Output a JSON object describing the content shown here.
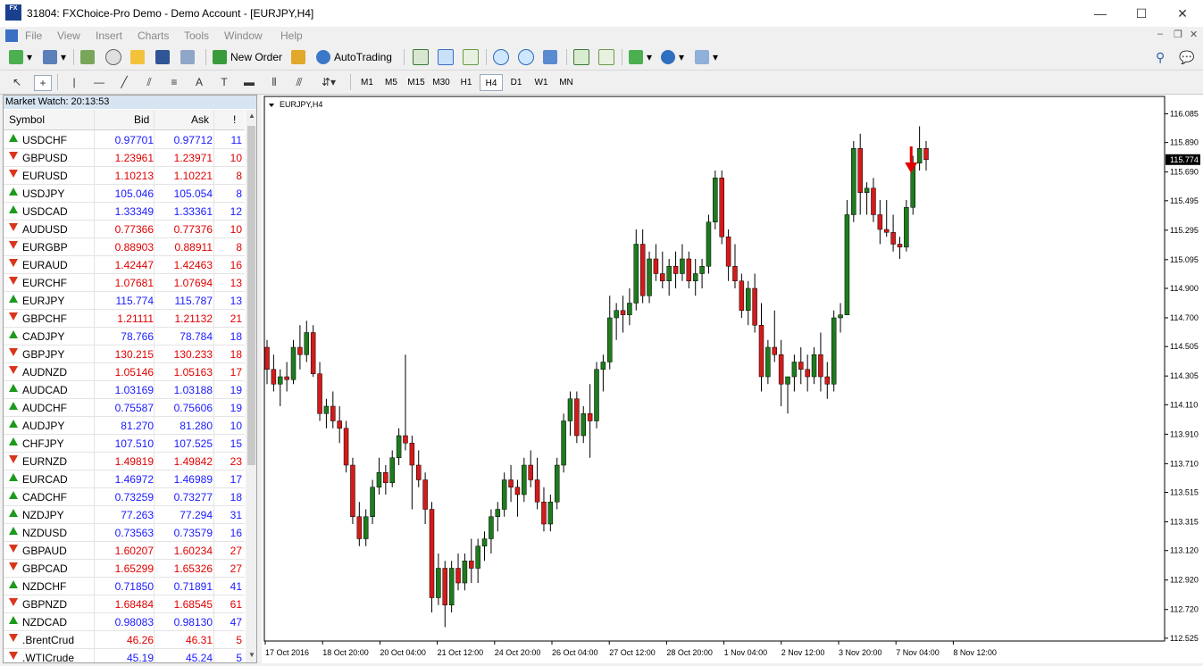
{
  "window": {
    "title": "31804: FXChoice-Pro Demo - Demo Account - [EURJPY,H4]",
    "app_icon_text": "FX",
    "minimize": "—",
    "maximize": "☐",
    "close": "✕"
  },
  "menu": [
    "File",
    "View",
    "Insert",
    "Charts",
    "Tools",
    "Window",
    "Help"
  ],
  "toolbar": {
    "new_order": "New Order",
    "auto_trading": "AutoTrading"
  },
  "timeframes": [
    "M1",
    "M5",
    "M15",
    "M30",
    "H1",
    "H4",
    "D1",
    "W1",
    "MN"
  ],
  "active_timeframe": "H4",
  "market_watch": {
    "title": "Market Watch: 20:13:53",
    "columns": [
      "Symbol",
      "Bid",
      "Ask",
      "!"
    ],
    "rows": [
      {
        "dir": "up",
        "symbol": "USDCHF",
        "bid": "0.97701",
        "ask": "0.97712",
        "spread": "11",
        "color": "#1a1aff"
      },
      {
        "dir": "down",
        "symbol": "GBPUSD",
        "bid": "1.23961",
        "ask": "1.23971",
        "spread": "10",
        "color": "#e00000"
      },
      {
        "dir": "down",
        "symbol": "EURUSD",
        "bid": "1.10213",
        "ask": "1.10221",
        "spread": "8",
        "color": "#e00000"
      },
      {
        "dir": "up",
        "symbol": "USDJPY",
        "bid": "105.046",
        "ask": "105.054",
        "spread": "8",
        "color": "#1a1aff"
      },
      {
        "dir": "up",
        "symbol": "USDCAD",
        "bid": "1.33349",
        "ask": "1.33361",
        "spread": "12",
        "color": "#1a1aff"
      },
      {
        "dir": "down",
        "symbol": "AUDUSD",
        "bid": "0.77366",
        "ask": "0.77376",
        "spread": "10",
        "color": "#e00000"
      },
      {
        "dir": "down",
        "symbol": "EURGBP",
        "bid": "0.88903",
        "ask": "0.88911",
        "spread": "8",
        "color": "#e00000"
      },
      {
        "dir": "down",
        "symbol": "EURAUD",
        "bid": "1.42447",
        "ask": "1.42463",
        "spread": "16",
        "color": "#e00000"
      },
      {
        "dir": "down",
        "symbol": "EURCHF",
        "bid": "1.07681",
        "ask": "1.07694",
        "spread": "13",
        "color": "#e00000"
      },
      {
        "dir": "up",
        "symbol": "EURJPY",
        "bid": "115.774",
        "ask": "115.787",
        "spread": "13",
        "color": "#1a1aff"
      },
      {
        "dir": "down",
        "symbol": "GBPCHF",
        "bid": "1.21111",
        "ask": "1.21132",
        "spread": "21",
        "color": "#e00000"
      },
      {
        "dir": "up",
        "symbol": "CADJPY",
        "bid": "78.766",
        "ask": "78.784",
        "spread": "18",
        "color": "#1a1aff"
      },
      {
        "dir": "down",
        "symbol": "GBPJPY",
        "bid": "130.215",
        "ask": "130.233",
        "spread": "18",
        "color": "#e00000"
      },
      {
        "dir": "down",
        "symbol": "AUDNZD",
        "bid": "1.05146",
        "ask": "1.05163",
        "spread": "17",
        "color": "#e00000"
      },
      {
        "dir": "up",
        "symbol": "AUDCAD",
        "bid": "1.03169",
        "ask": "1.03188",
        "spread": "19",
        "color": "#1a1aff"
      },
      {
        "dir": "up",
        "symbol": "AUDCHF",
        "bid": "0.75587",
        "ask": "0.75606",
        "spread": "19",
        "color": "#1a1aff"
      },
      {
        "dir": "up",
        "symbol": "AUDJPY",
        "bid": "81.270",
        "ask": "81.280",
        "spread": "10",
        "color": "#1a1aff"
      },
      {
        "dir": "up",
        "symbol": "CHFJPY",
        "bid": "107.510",
        "ask": "107.525",
        "spread": "15",
        "color": "#1a1aff"
      },
      {
        "dir": "down",
        "symbol": "EURNZD",
        "bid": "1.49819",
        "ask": "1.49842",
        "spread": "23",
        "color": "#e00000"
      },
      {
        "dir": "up",
        "symbol": "EURCAD",
        "bid": "1.46972",
        "ask": "1.46989",
        "spread": "17",
        "color": "#1a1aff"
      },
      {
        "dir": "up",
        "symbol": "CADCHF",
        "bid": "0.73259",
        "ask": "0.73277",
        "spread": "18",
        "color": "#1a1aff"
      },
      {
        "dir": "up",
        "symbol": "NZDJPY",
        "bid": "77.263",
        "ask": "77.294",
        "spread": "31",
        "color": "#1a1aff"
      },
      {
        "dir": "up",
        "symbol": "NZDUSD",
        "bid": "0.73563",
        "ask": "0.73579",
        "spread": "16",
        "color": "#1a1aff"
      },
      {
        "dir": "down",
        "symbol": "GBPAUD",
        "bid": "1.60207",
        "ask": "1.60234",
        "spread": "27",
        "color": "#e00000"
      },
      {
        "dir": "down",
        "symbol": "GBPCAD",
        "bid": "1.65299",
        "ask": "1.65326",
        "spread": "27",
        "color": "#e00000"
      },
      {
        "dir": "up",
        "symbol": "NZDCHF",
        "bid": "0.71850",
        "ask": "0.71891",
        "spread": "41",
        "color": "#1a1aff"
      },
      {
        "dir": "down",
        "symbol": "GBPNZD",
        "bid": "1.68484",
        "ask": "1.68545",
        "spread": "61",
        "color": "#e00000"
      },
      {
        "dir": "up",
        "symbol": "NZDCAD",
        "bid": "0.98083",
        "ask": "0.98130",
        "spread": "47",
        "color": "#1a1aff"
      },
      {
        "dir": "down",
        "symbol": ".BrentCrud",
        "bid": "46.26",
        "ask": "46.31",
        "spread": "5",
        "color": "#e00000"
      },
      {
        "dir": "down",
        "symbol": ".WTICrude",
        "bid": "45.19",
        "ask": "45.24",
        "spread": "5",
        "color": "#1a1aff"
      }
    ]
  },
  "chart_data": {
    "type": "candlestick",
    "title": "EURJPY,H4",
    "current_price": "115.774",
    "ylim": [
      112.5,
      116.1
    ],
    "y_ticks": [
      "116.085",
      "115.890",
      "115.690",
      "115.495",
      "115.295",
      "115.095",
      "114.900",
      "114.700",
      "114.505",
      "114.305",
      "114.110",
      "113.910",
      "113.710",
      "113.515",
      "113.315",
      "113.120",
      "112.920",
      "112.720",
      "112.525"
    ],
    "x_labels": [
      "17 Oct 2016",
      "18 Oct 20:00",
      "20 Oct 04:00",
      "21 Oct 12:00",
      "24 Oct 20:00",
      "26 Oct 04:00",
      "27 Oct 12:00",
      "28 Oct 20:00",
      "1 Nov 04:00",
      "2 Nov 12:00",
      "3 Nov 20:00",
      "7 Nov 04:00",
      "8 Nov 12:00"
    ],
    "marker": "down-arrow above 7 Nov 04:00 candle",
    "candles": [
      [
        114.5,
        114.55,
        114.25,
        114.35
      ],
      [
        114.35,
        114.45,
        114.2,
        114.25
      ],
      [
        114.25,
        114.35,
        114.1,
        114.3
      ],
      [
        114.3,
        114.4,
        114.2,
        114.28
      ],
      [
        114.28,
        114.55,
        114.25,
        114.5
      ],
      [
        114.5,
        114.65,
        114.35,
        114.45
      ],
      [
        114.45,
        114.68,
        114.4,
        114.6
      ],
      [
        114.6,
        114.65,
        114.3,
        114.32
      ],
      [
        114.32,
        114.4,
        114.0,
        114.05
      ],
      [
        114.05,
        114.15,
        113.95,
        114.1
      ],
      [
        114.1,
        114.2,
        113.95,
        114.0
      ],
      [
        114.0,
        114.1,
        113.85,
        113.95
      ],
      [
        113.95,
        114.0,
        113.65,
        113.7
      ],
      [
        113.7,
        113.75,
        113.3,
        113.35
      ],
      [
        113.35,
        113.45,
        113.15,
        113.2
      ],
      [
        113.2,
        113.4,
        113.15,
        113.35
      ],
      [
        113.35,
        113.6,
        113.3,
        113.55
      ],
      [
        113.55,
        113.75,
        113.5,
        113.65
      ],
      [
        113.65,
        113.7,
        113.5,
        113.58
      ],
      [
        113.58,
        113.8,
        113.55,
        113.75
      ],
      [
        113.75,
        113.95,
        113.7,
        113.9
      ],
      [
        113.9,
        114.45,
        113.8,
        113.85
      ],
      [
        113.85,
        113.9,
        113.4,
        113.7
      ],
      [
        113.7,
        113.8,
        113.55,
        113.6
      ],
      [
        113.6,
        113.65,
        113.3,
        113.4
      ],
      [
        113.4,
        113.45,
        112.7,
        112.8
      ],
      [
        112.8,
        113.1,
        112.75,
        113.0
      ],
      [
        113.0,
        113.05,
        112.6,
        112.75
      ],
      [
        112.75,
        113.05,
        112.7,
        113.0
      ],
      [
        113.0,
        113.1,
        112.85,
        112.9
      ],
      [
        112.9,
        113.1,
        112.85,
        113.05
      ],
      [
        113.05,
        113.2,
        112.9,
        113.0
      ],
      [
        113.0,
        113.2,
        112.9,
        113.15
      ],
      [
        113.15,
        113.25,
        113.05,
        113.2
      ],
      [
        113.2,
        113.4,
        113.1,
        113.35
      ],
      [
        113.35,
        113.45,
        113.25,
        113.4
      ],
      [
        113.4,
        113.65,
        113.35,
        113.6
      ],
      [
        113.6,
        113.7,
        113.45,
        113.55
      ],
      [
        113.55,
        113.6,
        113.35,
        113.5
      ],
      [
        113.5,
        113.75,
        113.45,
        113.7
      ],
      [
        113.7,
        113.8,
        113.55,
        113.6
      ],
      [
        113.6,
        113.75,
        113.4,
        113.45
      ],
      [
        113.45,
        113.55,
        113.25,
        113.3
      ],
      [
        113.3,
        113.5,
        113.25,
        113.45
      ],
      [
        113.45,
        113.75,
        113.4,
        113.7
      ],
      [
        113.7,
        114.05,
        113.65,
        114.0
      ],
      [
        114.0,
        114.2,
        113.9,
        114.15
      ],
      [
        114.15,
        114.2,
        113.85,
        113.9
      ],
      [
        113.9,
        114.1,
        113.85,
        114.05
      ],
      [
        114.05,
        114.25,
        113.75,
        114.0
      ],
      [
        114.0,
        114.4,
        113.95,
        114.35
      ],
      [
        114.35,
        114.45,
        114.2,
        114.4
      ],
      [
        114.4,
        114.85,
        114.35,
        114.7
      ],
      [
        114.7,
        114.8,
        114.55,
        114.75
      ],
      [
        114.75,
        114.85,
        114.6,
        114.72
      ],
      [
        114.72,
        114.9,
        114.65,
        114.8
      ],
      [
        114.8,
        115.3,
        114.75,
        115.2
      ],
      [
        115.2,
        115.3,
        114.8,
        114.85
      ],
      [
        114.85,
        115.15,
        114.8,
        115.1
      ],
      [
        115.1,
        115.2,
        114.95,
        115.0
      ],
      [
        115.0,
        115.15,
        114.9,
        114.95
      ],
      [
        114.95,
        115.1,
        114.85,
        115.05
      ],
      [
        115.05,
        115.15,
        114.9,
        115.0
      ],
      [
        115.0,
        115.2,
        114.95,
        115.1
      ],
      [
        115.1,
        115.15,
        114.9,
        114.95
      ],
      [
        114.95,
        115.1,
        114.85,
        115.0
      ],
      [
        115.0,
        115.1,
        114.9,
        115.05
      ],
      [
        115.05,
        115.4,
        115.0,
        115.35
      ],
      [
        115.35,
        115.7,
        115.3,
        115.65
      ],
      [
        115.65,
        115.7,
        115.2,
        115.25
      ],
      [
        115.25,
        115.3,
        114.95,
        115.05
      ],
      [
        115.05,
        115.2,
        114.9,
        114.95
      ],
      [
        114.95,
        115.0,
        114.7,
        114.75
      ],
      [
        114.75,
        114.95,
        114.65,
        114.9
      ],
      [
        114.9,
        115.0,
        114.6,
        114.65
      ],
      [
        114.65,
        114.8,
        114.2,
        114.3
      ],
      [
        114.3,
        114.55,
        114.25,
        114.5
      ],
      [
        114.5,
        114.75,
        114.4,
        114.45
      ],
      [
        114.45,
        114.55,
        114.1,
        114.25
      ],
      [
        114.25,
        114.3,
        114.05,
        114.3
      ],
      [
        114.3,
        114.45,
        114.2,
        114.4
      ],
      [
        114.4,
        114.5,
        114.25,
        114.35
      ],
      [
        114.35,
        114.45,
        114.2,
        114.3
      ],
      [
        114.3,
        114.5,
        114.25,
        114.45
      ],
      [
        114.45,
        114.6,
        114.2,
        114.3
      ],
      [
        114.3,
        114.4,
        114.15,
        114.25
      ],
      [
        114.25,
        114.75,
        114.2,
        114.7
      ],
      [
        114.7,
        114.8,
        114.6,
        114.72
      ],
      [
        114.72,
        115.5,
        114.85,
        115.4
      ],
      [
        115.4,
        115.9,
        115.35,
        115.85
      ],
      [
        115.85,
        115.95,
        115.4,
        115.55
      ],
      [
        115.55,
        115.62,
        115.4,
        115.58
      ],
      [
        115.58,
        115.65,
        115.35,
        115.4
      ],
      [
        115.4,
        115.5,
        115.2,
        115.3
      ],
      [
        115.3,
        115.5,
        115.25,
        115.28
      ],
      [
        115.28,
        115.4,
        115.15,
        115.2
      ],
      [
        115.2,
        115.25,
        115.1,
        115.18
      ],
      [
        115.18,
        115.5,
        115.15,
        115.45
      ],
      [
        115.45,
        115.8,
        115.4,
        115.75
      ],
      [
        115.75,
        116.0,
        115.7,
        115.85
      ],
      [
        115.85,
        115.9,
        115.7,
        115.774
      ]
    ]
  }
}
